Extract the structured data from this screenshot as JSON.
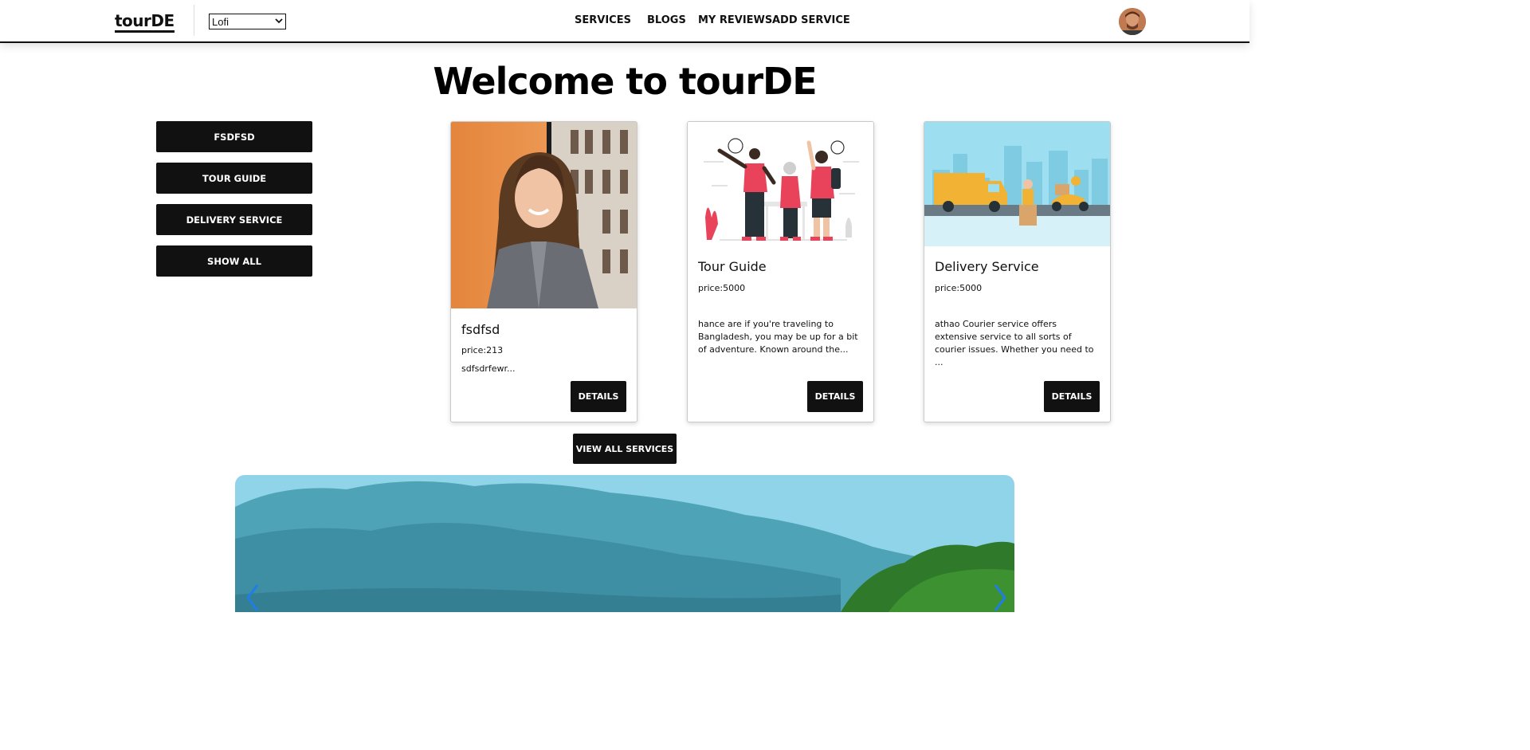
{
  "navbar": {
    "brand": "tourDE",
    "theme_select": {
      "value": "Lofi"
    },
    "links": [
      {
        "label": "SERVICES"
      },
      {
        "label": "BLOGS"
      },
      {
        "label": "MY REVIEWS"
      },
      {
        "label": "ADD SERVICE"
      }
    ],
    "avatar_icon": "user-avatar"
  },
  "main": {
    "heading": "Welcome to tourDE",
    "filters": [
      {
        "label": "FSDFSD"
      },
      {
        "label": "TOUR GUIDE"
      },
      {
        "label": "DELIVERY SERVICE"
      },
      {
        "label": "SHOW ALL"
      }
    ],
    "cards": [
      {
        "title": "fsdfsd",
        "price": "price:213",
        "description": "sdfsdrfewr...",
        "details_label": "DETAILS"
      },
      {
        "title": "Tour Guide",
        "price": "price:5000",
        "description": "hance are if you're traveling to Bangladesh, you may be up for a bit of adventure. Known around the...",
        "details_label": "DETAILS"
      },
      {
        "title": "Delivery Service",
        "price": "price:5000",
        "description": "athao Courier service offers extensive service to all sorts of courier issues. Whether you need to ...",
        "details_label": "DETAILS"
      }
    ],
    "view_all_label": "VIEW ALL SERVICES"
  },
  "carousel": {
    "prev_icon": "chevron-left-icon",
    "next_icon": "chevron-right-icon"
  },
  "colors": {
    "button_bg": "#111111",
    "button_text": "#ffffff",
    "accent_arrow": "#1e7ee6",
    "sky": "#8fd4e8"
  }
}
